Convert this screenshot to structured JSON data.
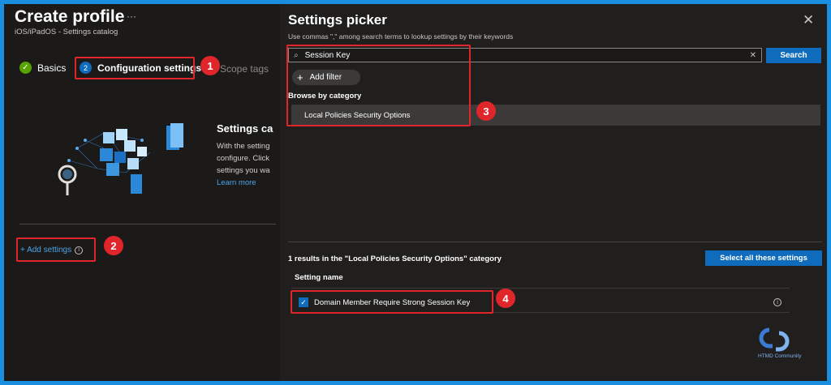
{
  "left": {
    "title": "Create profile",
    "more": "···",
    "subtitle": "iOS/iPadOS - Settings catalog",
    "steps": [
      {
        "label": "Basics"
      },
      {
        "label": "Configuration settings"
      },
      {
        "label": "Scope tags"
      }
    ],
    "info_title": "Settings ca",
    "info_lines": [
      "With the setting",
      "configure. Click",
      "settings you wa"
    ],
    "learn_more": "Learn more",
    "add_settings": "+ Add settings"
  },
  "picker": {
    "title": "Settings picker",
    "hint": "Use commas \",\" among search terms to lookup settings by their keywords",
    "search_value": "Session Key",
    "search_button": "Search",
    "add_filter": "Add filter",
    "browse_label": "Browse by category",
    "category": "Local Policies Security Options",
    "results_text": "1 results in the \"Local Policies Security Options\" category",
    "select_all": "Select all these settings",
    "column_header": "Setting name",
    "setting": "Domain Member Require Strong Session Key",
    "setting_checked": true
  },
  "callouts": [
    "1",
    "2",
    "3",
    "4"
  ],
  "watermark": "HTMD Community",
  "colors": {
    "accent": "#0f6cbd",
    "callout": "#e0262b",
    "frame": "#1a8fe0"
  }
}
